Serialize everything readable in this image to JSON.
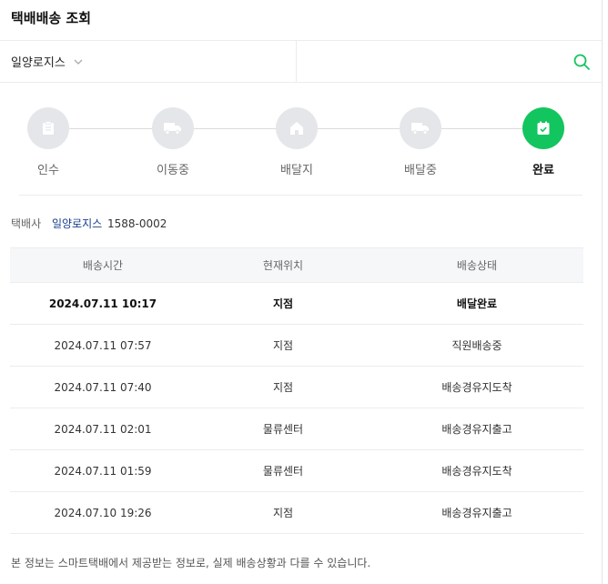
{
  "header": {
    "title": "택배배송 조회"
  },
  "search": {
    "carrier": "일양로지스",
    "placeholder": ""
  },
  "steps": [
    {
      "label": "인수",
      "icon": "clipboard-icon",
      "active": false
    },
    {
      "label": "이동중",
      "icon": "truck-icon",
      "active": false
    },
    {
      "label": "배달지",
      "icon": "house-icon",
      "active": false
    },
    {
      "label": "배달중",
      "icon": "truck-icon",
      "active": false
    },
    {
      "label": "완료",
      "icon": "check-clipboard-icon",
      "active": true
    }
  ],
  "carrier_info": {
    "label": "택배사",
    "name": "일양로지스",
    "phone": "1588-0002"
  },
  "table": {
    "headers": [
      "배송시간",
      "현재위치",
      "배송상태"
    ],
    "rows": [
      {
        "time": "2024.07.11 10:17",
        "location": "지점",
        "status": "배달완료"
      },
      {
        "time": "2024.07.11 07:57",
        "location": "지점",
        "status": "직원배송중"
      },
      {
        "time": "2024.07.11 07:40",
        "location": "지점",
        "status": "배송경유지도착"
      },
      {
        "time": "2024.07.11 02:01",
        "location": "물류센터",
        "status": "배송경유지출고"
      },
      {
        "time": "2024.07.11 01:59",
        "location": "물류센터",
        "status": "배송경유지도착"
      },
      {
        "time": "2024.07.10 19:26",
        "location": "지점",
        "status": "배송경유지출고"
      }
    ]
  },
  "notice": "본 정보는 스마트택배에서 제공받는 정보로, 실제 배송상황과 다를 수 있습니다.",
  "colors": {
    "accent": "#13c55e",
    "inactive_step": "#e4e6ea",
    "carrier_link": "#1a3f8f"
  }
}
